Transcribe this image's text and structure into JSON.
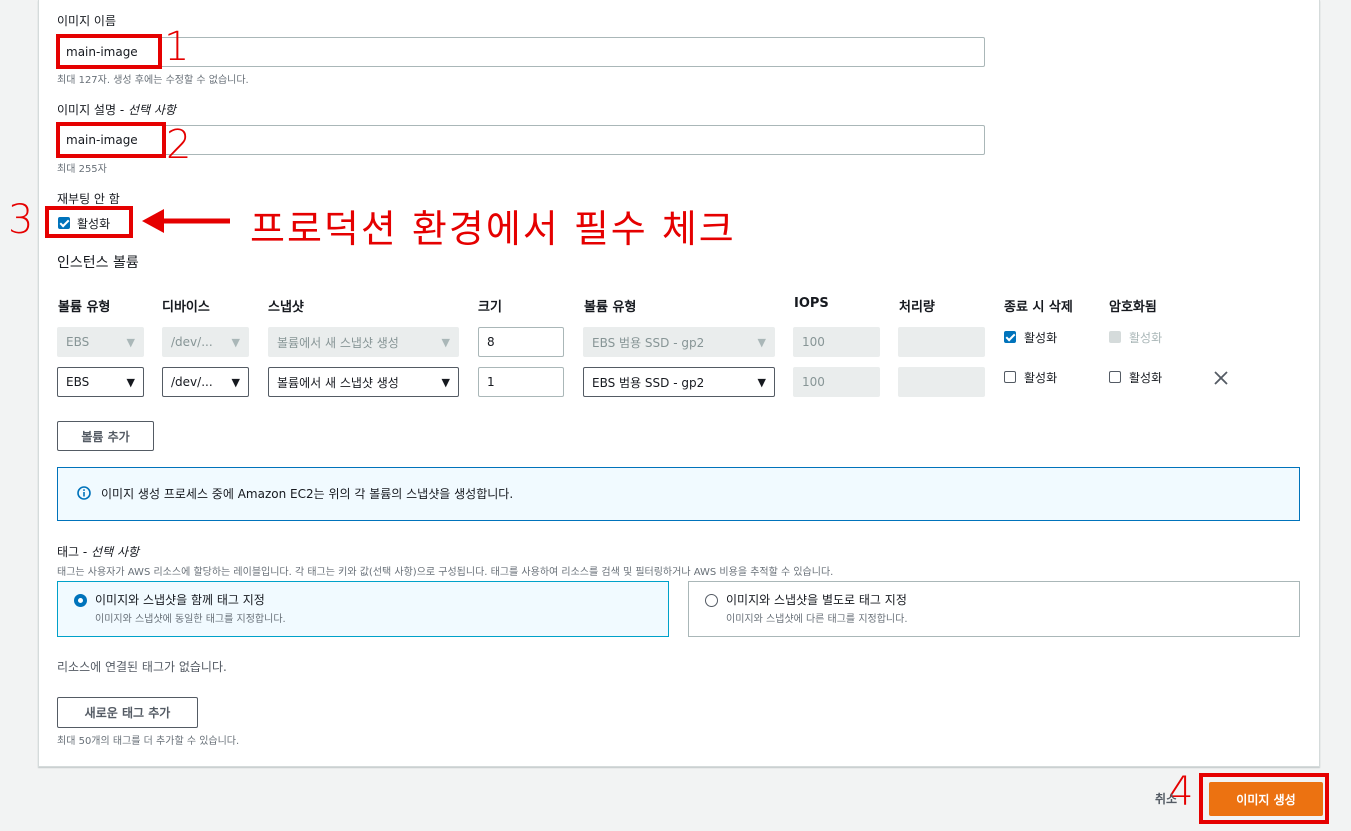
{
  "image_name": {
    "label": "이미지 이름",
    "value": "main-image",
    "hint": "최대 127자. 생성 후에는 수정할 수 없습니다."
  },
  "image_description": {
    "label": "이미지 설명 - ",
    "label_optional": "선택 사항",
    "value": "main-image",
    "hint": "최대 255자"
  },
  "no_reboot": {
    "label": "재부팅 안 함",
    "checkbox_label": "활성화",
    "checked": true
  },
  "annotations": {
    "n1": "1",
    "n2": "2",
    "n3": "3",
    "n4": "4",
    "arrow_text": "프로덕션 환경에서 필수 체크",
    "color": "#e50000"
  },
  "volumes": {
    "section_title": "인스턴스 볼륨",
    "headers": [
      "볼륨 유형",
      "디바이스",
      "스냅샷",
      "크기",
      "볼륨 유형",
      "IOPS",
      "처리량",
      "종료 시 삭제",
      "암호화됨"
    ],
    "rows": [
      {
        "type": "EBS",
        "device": "/dev/...",
        "snapshot": "볼륨에서 새 스냅샷 생성",
        "size": "8",
        "volume_type": "EBS 범용 SSD - gp2",
        "iops": "100",
        "throughput": "",
        "delete_label": "활성화",
        "delete_checked": true,
        "encrypted_label": "활성화",
        "encrypted_checked": false,
        "disabled": true
      },
      {
        "type": "EBS",
        "device": "/dev/...",
        "snapshot": "볼륨에서 새 스냅샷 생성",
        "size": "1",
        "volume_type": "EBS 범용 SSD - gp2",
        "iops": "100",
        "throughput": "",
        "delete_label": "활성화",
        "delete_checked": false,
        "encrypted_label": "활성화",
        "encrypted_checked": false,
        "disabled": false
      }
    ],
    "add_button": "볼륨 추가",
    "remove_icon": "close-icon"
  },
  "info_box": {
    "icon": "info-icon",
    "text": "이미지 생성 프로세스 중에 Amazon EC2는 위의 각 볼륨의 스냅샷을 생성합니다."
  },
  "tags": {
    "label": "태그 - ",
    "label_optional": "선택 사항",
    "description": "태그는 사용자가 AWS 리소스에 할당하는 레이블입니다. 각 태그는 키와 값(선택 사항)으로 구성됩니다. 태그를 사용하여 리소스를 검색 및 필터링하거나 AWS 비용을 추적할 수 있습니다.",
    "options": [
      {
        "title": "이미지와 스냅샷을 함께 태그 지정",
        "desc": "이미지와 스냅샷에 동일한 태그를 지정합니다.",
        "selected": true
      },
      {
        "title": "이미지와 스냅샷을 별도로 태그 지정",
        "desc": "이미지와 스냅샷에 다른 태그를 지정합니다.",
        "selected": false
      }
    ],
    "empty_text": "리소스에 연결된 태그가 없습니다.",
    "add_button": "새로운 태그 추가",
    "add_hint": "최대 50개의 태그를 더 추가할 수 있습니다."
  },
  "footer": {
    "cancel": "취소",
    "create": "이미지 생성",
    "primary_color": "#ec7211"
  }
}
